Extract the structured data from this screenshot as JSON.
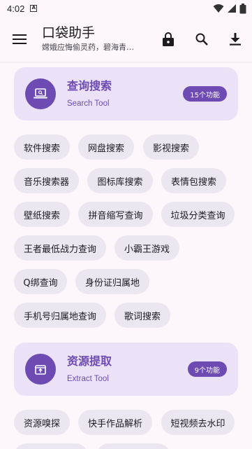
{
  "status_bar": {
    "time": "4:02",
    "notif_letter": "A"
  },
  "app_bar": {
    "title": "口袋助手",
    "subtitle": "嫦娥应悔偷灵药，碧海青…"
  },
  "sections": [
    {
      "title": "查询搜索",
      "subtitle": "Search Tool",
      "badge": "15个功能",
      "icon": "laptop-search-icon",
      "tools": [
        "软件搜索",
        "网盘搜索",
        "影视搜索",
        "音乐搜索器",
        "图标库搜索",
        "表情包搜索",
        "壁纸搜索",
        "拼音缩写查询",
        "垃圾分类查询",
        "王者最低战力查询",
        "小霸王游戏",
        "Q绑查询",
        "身份证归属地",
        "手机号归属地查询",
        "歌词搜索"
      ]
    },
    {
      "title": "资源提取",
      "subtitle": "Extract Tool",
      "badge": "9个功能",
      "icon": "extract-box-icon",
      "tools": [
        "资源嗅探",
        "快手作品解析",
        "短视频去水印"
      ]
    }
  ],
  "colors": {
    "accent": "#6d4bb3",
    "card": "#ebe2f8",
    "chip": "#ece6f0",
    "background": "#fdf7fb"
  }
}
